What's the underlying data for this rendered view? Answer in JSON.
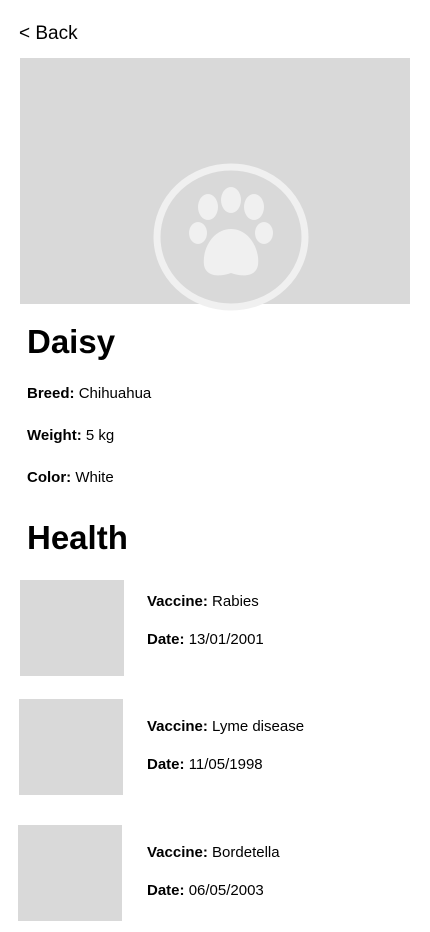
{
  "nav": {
    "back_label": "< Back"
  },
  "pet": {
    "name": "Daisy",
    "image_icon": "paw-icon",
    "attributes": [
      {
        "label": "Breed:",
        "value": "Chihuahua"
      },
      {
        "label": "Weight:",
        "value": "5 kg"
      },
      {
        "label": "Color:",
        "value": "White"
      }
    ]
  },
  "health": {
    "title": "Health",
    "vaccines": [
      {
        "vaccine_label": "Vaccine:",
        "vaccine": "Rabies",
        "date_label": "Date:",
        "date": "13/01/2001"
      },
      {
        "vaccine_label": "Vaccine:",
        "vaccine": "Lyme disease",
        "date_label": "Date:",
        "date": "11/05/1998"
      },
      {
        "vaccine_label": "Vaccine:",
        "vaccine": "Bordetella",
        "date_label": "Date:",
        "date": "06/05/2003"
      }
    ]
  },
  "colors": {
    "placeholder": "#d9d9d9",
    "placeholder_icon": "#f0f0f0",
    "text": "#000000"
  }
}
